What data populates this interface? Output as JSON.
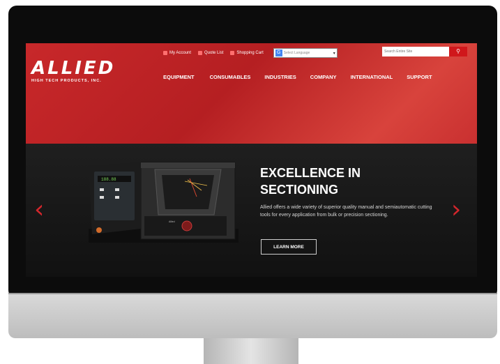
{
  "site": {
    "logo": {
      "word": "ALLIED",
      "tagline": "HIGH TECH PRODUCTS, INC."
    },
    "topbar": {
      "my_account": "My Account",
      "quote_list": "Quote List",
      "shopping_cart": "Shopping Cart",
      "language_select": "Select Language",
      "search_placeholder": "Search Entire Site"
    },
    "nav": [
      "EQUIPMENT",
      "CONSUMABLES",
      "INDUSTRIES",
      "COMPANY",
      "INTERNATIONAL",
      "SUPPORT"
    ],
    "hero": {
      "title_line1": "EXCELLENCE IN",
      "title_line2": "SECTIONING",
      "body": "Allied offers a wide variety of superior quality manual and semiautomatic cutting tools for every application from bulk or precision sectioning.",
      "button": "LEARN MORE"
    },
    "colors": {
      "brand_red": "#c8282a",
      "hero_bg": "#181818",
      "accent": "#d3262c"
    }
  }
}
